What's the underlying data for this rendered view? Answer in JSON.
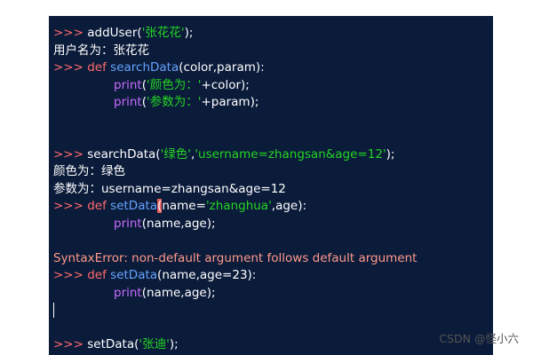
{
  "prompt": ">>>",
  "code": {
    "l1": {
      "call": "addUser(",
      "arg": "'张花花'",
      "end": ");"
    },
    "l2": {
      "text": "用户名为：张花花"
    },
    "l3": {
      "kw": "def",
      "fn": "searchData",
      "rest": "(color,param):"
    },
    "l4": {
      "print": "print",
      "open": "(",
      "str": "'颜色为：'",
      "rest": "+color);"
    },
    "l5": {
      "print": "print",
      "open": "(",
      "str": "'参数为：'",
      "rest": "+param);"
    },
    "l6": {
      "call": "searchData(",
      "arg1": "'绿色'",
      "comma": ",",
      "arg2": "'username=zhangsan&age=12'",
      "end": ");"
    },
    "l7": {
      "text": "颜色为：绿色"
    },
    "l8": {
      "text": "参数为：username=zhangsan&age=12"
    },
    "l9": {
      "kw": "def",
      "fn": "setData",
      "paren": "(",
      "a": "name=",
      "str": "'zhanghua'",
      "rest": ",age):"
    },
    "l10": {
      "print": "print",
      "rest": "(name,age);"
    },
    "l11": {
      "text": "SyntaxError: non-default argument follows default argument"
    },
    "l12": {
      "kw": "def",
      "fn": "setData",
      "rest": "(name,age=23):"
    },
    "l13": {
      "print": "print",
      "rest": "(name,age);"
    },
    "l14": {
      "call": "setData(",
      "arg": "'张迪'",
      "end": ");"
    }
  },
  "watermark": "CSDN @怪小六",
  "colors": {
    "background": "#0b1b3a",
    "prompt": "#ff6b6b",
    "keyword": "#ff6b6b",
    "function": "#66a3ff",
    "builtin": "#c86bff",
    "string": "#23d623",
    "error": "#ff9a8b"
  }
}
